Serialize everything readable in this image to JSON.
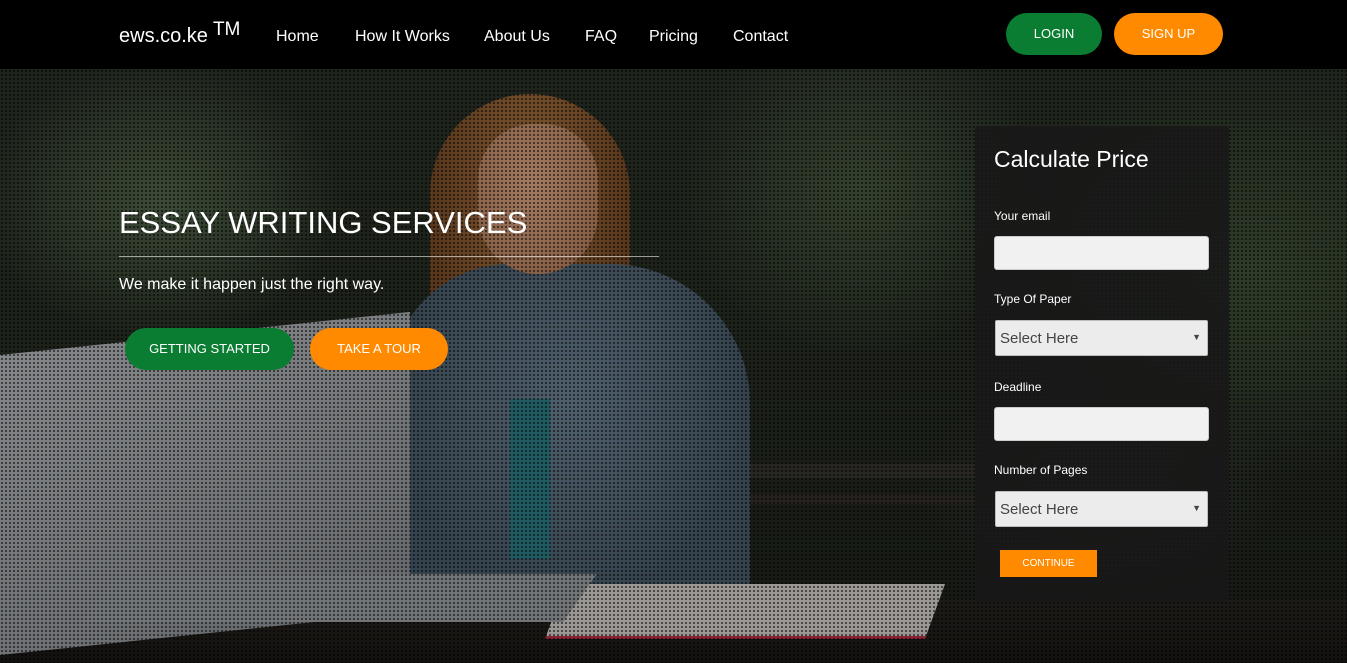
{
  "brand": {
    "name": "ews.co.ke",
    "mark": "TM"
  },
  "nav": {
    "links": [
      "Home",
      "How It Works",
      "About Us",
      "FAQ",
      "Pricing",
      "Contact"
    ],
    "login_label": "LOGIN",
    "signup_label": "SIGN UP"
  },
  "hero": {
    "title": "ESSAY WRITING SERVICES",
    "subtitle": "We make it happen just the right way.",
    "start_label": "GETTING STARTED",
    "tour_label": "TAKE A TOUR"
  },
  "calculator": {
    "title": "Calculate Price",
    "email_label": "Your email",
    "email_value": "",
    "paper_label": "Type Of Paper",
    "paper_selected": "Select Here",
    "deadline_label": "Deadline",
    "deadline_value": "",
    "pages_label": "Number of Pages",
    "pages_selected": "Select Here",
    "continue_label": "CONTINUE"
  },
  "colors": {
    "green": "#0a7d32",
    "orange": "#ff8a00",
    "navbar": "#000000"
  }
}
